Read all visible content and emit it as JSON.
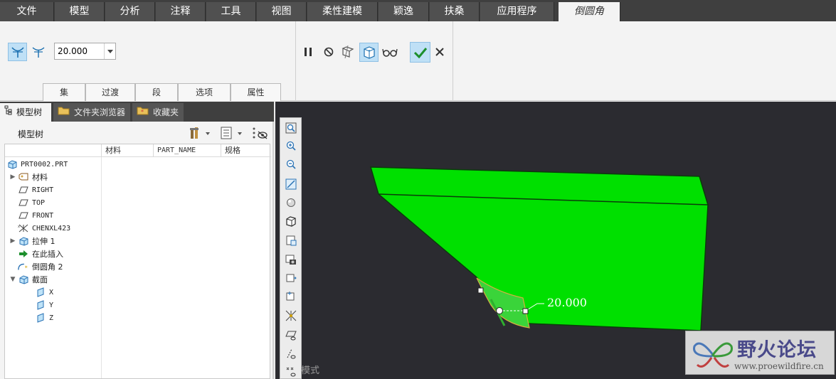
{
  "menubar": {
    "tabs": [
      {
        "label": "文件"
      },
      {
        "label": "模型"
      },
      {
        "label": "分析"
      },
      {
        "label": "注释"
      },
      {
        "label": "工具"
      },
      {
        "label": "视图"
      },
      {
        "label": "柔性建模"
      },
      {
        "label": "颖逸"
      },
      {
        "label": "扶桑"
      },
      {
        "label": "应用程序"
      }
    ],
    "active_tab": "倒圆角"
  },
  "ribbon": {
    "radius_value": "20.000",
    "subtabs": [
      "集",
      "过渡",
      "段",
      "选项",
      "属性"
    ]
  },
  "leftpane": {
    "tabs": [
      "模型树",
      "文件夹浏览器",
      "收藏夹"
    ],
    "tree_title": "模型树",
    "columns": [
      "材料",
      "PART_NAME",
      "规格"
    ],
    "tree_items": [
      {
        "label": "PRT0002.PRT",
        "icon": "part-icon"
      },
      {
        "label": "材料",
        "icon": "material-icon"
      },
      {
        "label": "RIGHT",
        "icon": "datum-plane-icon"
      },
      {
        "label": "TOP",
        "icon": "datum-plane-icon"
      },
      {
        "label": "FRONT",
        "icon": "datum-plane-icon"
      },
      {
        "label": "CHENXL423",
        "icon": "coordinate-system-icon"
      },
      {
        "label": "拉伸 1",
        "icon": "extrude-icon"
      },
      {
        "label": "在此插入",
        "icon": "insert-here-icon"
      },
      {
        "label": "倒圆角 2",
        "icon": "round-icon"
      },
      {
        "label": "截面",
        "icon": "section-icon"
      },
      {
        "label": "X",
        "icon": "section-plane-icon"
      },
      {
        "label": "Y",
        "icon": "section-plane-icon"
      },
      {
        "label": "Z",
        "icon": "section-plane-icon"
      }
    ]
  },
  "viewport": {
    "dimension_label": "20.000",
    "mode_text": "模式",
    "model_color": "#00e000",
    "watermark": {
      "title": "野火论坛",
      "url": "www.proewildfire.cn"
    }
  },
  "colors": {
    "tab_bar": "#3f3f3f",
    "ribbon": "#f3f3f3",
    "viewport_bg": "#2b2b30",
    "accent": "#bfe0f6",
    "check": "#1c8f2c"
  }
}
